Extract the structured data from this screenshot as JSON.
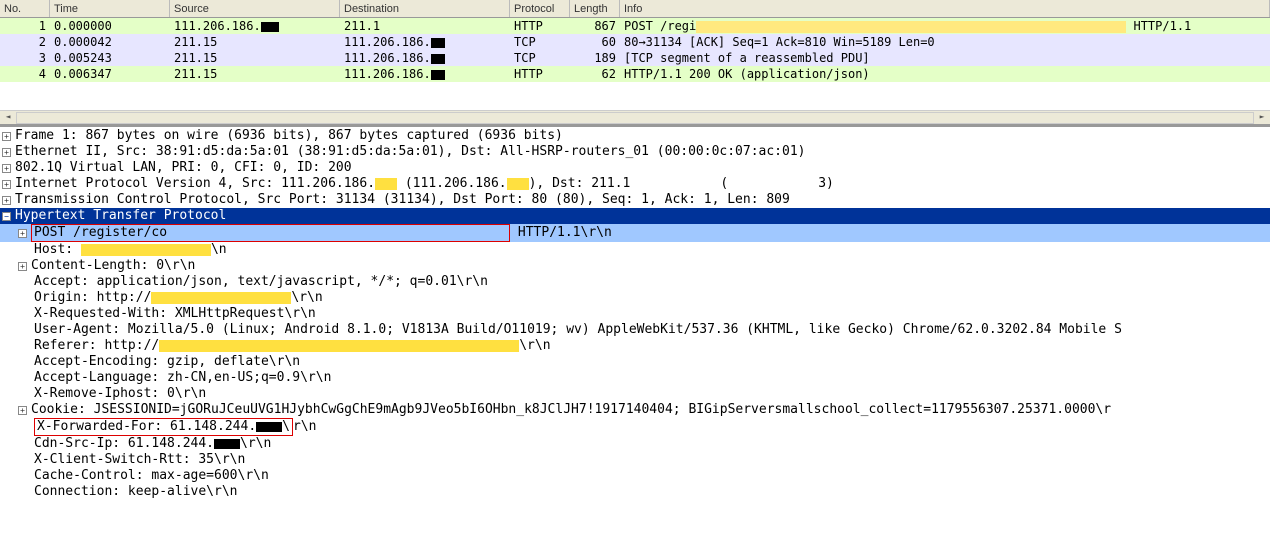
{
  "columns": {
    "no": "No.",
    "time": "Time",
    "src": "Source",
    "dst": "Destination",
    "proto": "Protocol",
    "len": "Length",
    "info": "Info"
  },
  "packets": [
    {
      "no": "1",
      "time": "0.000000",
      "src": "111.206.186.",
      "dst": "211.1",
      "proto": "HTTP",
      "len": "867",
      "info_pre": "POST /regi",
      "info_post": " HTTP/1.1",
      "cls": "row-http"
    },
    {
      "no": "2",
      "time": "0.000042",
      "src": "211.15",
      "dst": "111.206.186.",
      "proto": "TCP",
      "len": "60",
      "info_pre": "80→31134 [ACK] Seq=1 Ack=810 Win=5189 Len=0",
      "info_post": "",
      "cls": "row-tcp"
    },
    {
      "no": "3",
      "time": "0.005243",
      "src": "211.15",
      "dst": "111.206.186.",
      "proto": "TCP",
      "len": "189",
      "info_pre": "[TCP segment of a reassembled PDU]",
      "info_post": "",
      "cls": "row-tcp"
    },
    {
      "no": "4",
      "time": "0.006347",
      "src": "211.15",
      "dst": "111.206.186.",
      "proto": "HTTP",
      "len": "62",
      "info_pre": "HTTP/1.1 200 OK  (application/json)",
      "info_post": "",
      "cls": "row-http"
    }
  ],
  "tree": {
    "frame": "Frame 1: 867 bytes on wire (6936 bits), 867 bytes captured (6936 bits)",
    "eth": "Ethernet II, Src: 38:91:d5:da:5a:01 (38:91:d5:da:5a:01), Dst: All-HSRP-routers_01 (00:00:0c:07:ac:01)",
    "vlan": "802.1Q Virtual LAN, PRI: 0, CFI: 0, ID: 200",
    "ip_pre": "Internet Protocol Version 4, Src: 111.206.186.",
    "ip_mid": " (111.206.186.",
    "ip_end": "), Dst: 211.1",
    "ip_tail": "3)",
    "tcp": "Transmission Control Protocol, Src Port: 31134 (31134), Dst Port: 80 (80), Seq: 1, Ack: 1, Len: 809",
    "http": "Hypertext Transfer Protocol",
    "post_a": "POST /register/co",
    "post_b": " HTTP/1.1\\r\\n",
    "host_a": "Host: ",
    "host_b": "\\n",
    "clen": "Content-Length: 0\\r\\n",
    "accept": "Accept: application/json, text/javascript, */*; q=0.01\\r\\n",
    "origin_a": "Origin: http://",
    "origin_b": "\\r\\n",
    "xreq": "X-Requested-With: XMLHttpRequest\\r\\n",
    "ua": "User-Agent: Mozilla/5.0 (Linux; Android 8.1.0; V1813A Build/O11019; wv) AppleWebKit/537.36 (KHTML, like Gecko) Chrome/62.0.3202.84 Mobile S",
    "ref_a": "Referer: http://",
    "ref_b": "\\r\\n",
    "aenc": "Accept-Encoding: gzip, deflate\\r\\n",
    "alang": "Accept-Language: zh-CN,en-US;q=0.9\\r\\n",
    "xrip": "X-Remove-Iphost: 0\\r\\n",
    "cookie_a": "Cookie: JSESSIONID=jGORuJCeuUVG1",
    "cookie_b": "HJybhCwGgChE9mAgb9JVeo5bI6OHbn_k8JClJH7!1917140404; BIGipServersmallschool_collect=1179556307.25371.0000\\r",
    "xff_a": "X-Forwarded-For: 61.148.244.",
    "xff_b": "r\\n",
    "cdn_a": "Cdn-Src-Ip: 61.148.244.",
    "cdn_b": "\\r\\n",
    "xcsw": "X-Client-Switch-Rtt: 35\\r\\n",
    "cache": "Cache-Control: max-age=600\\r\\n",
    "conn": "Connection: keep-alive\\r\\n"
  }
}
